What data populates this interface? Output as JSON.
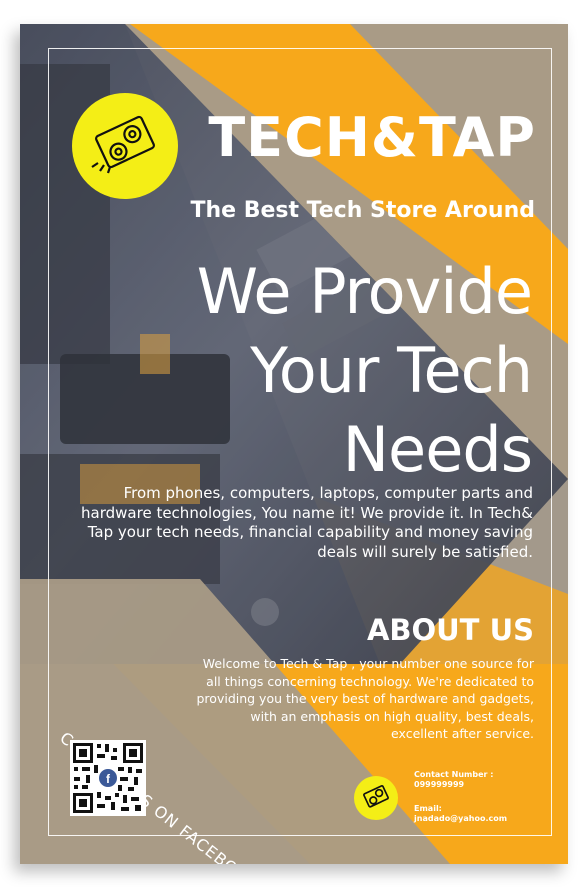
{
  "brand": {
    "name": "TECH&TAP",
    "tagline": "The Best Tech Store Around"
  },
  "headline": {
    "line1": "We Provide",
    "line2": "Your Tech",
    "line3": "Needs"
  },
  "intro": "From phones, computers, laptops, computer parts and hardware technologies, You name it! We provide it. In Tech& Tap your tech needs, financial capability and money saving deals will surely be satisfied.",
  "about": {
    "title": "ABOUT US",
    "body": "Welcome to Tech & Tap , your number one source for all things concerning technology. We're dedicated to providing you the very best of hardware and gadgets, with an emphasis on high quality, best deals, excellent after service."
  },
  "social": {
    "cta": "CONTACT US ON FACEBOOK",
    "qr_icon": "facebook-qr-code"
  },
  "contact": {
    "number_label": "Contact Number :",
    "number": "099999999",
    "email_label": "Email:",
    "email": "jnadado@yahoo.com"
  },
  "colors": {
    "accent_yellow": "#f7a81b",
    "logo_yellow": "#f4ee16",
    "taupe": "#a99b86",
    "text": "#ffffff"
  },
  "icons": {
    "logo": "graphics-card-icon"
  }
}
